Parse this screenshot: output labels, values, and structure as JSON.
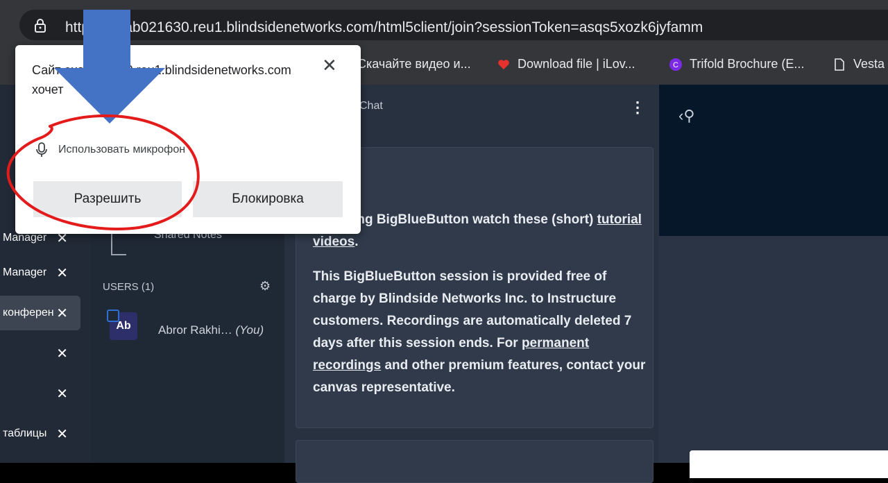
{
  "browser": {
    "url": "https://exab021630.reu1.blindsidenetworks.com/html5client/join?sessionToken=asqs5xozk6jyfamm",
    "url_visible": "https://exab021630.reu1.blindsidenetworks.com/html5client/join?sessionToken=asqs5xozk6jyfamm",
    "bookmarks": [
      {
        "label": "Скачайте видео и...",
        "icon": "video-icon"
      },
      {
        "label": "Download file | iLov...",
        "icon": "heart-icon"
      },
      {
        "label": "Trifold Brochure (E...",
        "icon": "canva-icon"
      },
      {
        "label": "Vesta",
        "icon": "page-icon"
      }
    ]
  },
  "left_strip": {
    "items": [
      {
        "label": "",
        "close": ""
      },
      {
        "label": "Manager",
        "close": "✕"
      },
      {
        "label": "Manager",
        "close": "✕"
      },
      {
        "label": "конферен",
        "close": "✕"
      },
      {
        "label": "",
        "close": "✕"
      },
      {
        "label": "",
        "close": "✕"
      },
      {
        "label": "таблицы",
        "close": "✕"
      }
    ]
  },
  "userlist": {
    "shared_notes": "Shared Notes",
    "users_header": "USERS (1)",
    "user": {
      "initials": "Ab",
      "name": "Abror Rakhi…",
      "you": "(You)"
    }
  },
  "chat": {
    "title": "Chat",
    "message_p1_pre": "…p using BigBlueButton watch these (short) ",
    "message_p1_link": "tutorial videos",
    "message_p1_post": ".",
    "message_p2_pre": "This BigBlueButton session is provided free of charge by Blindside Networks Inc. to Instructure customers. Recordings are automatically deleted 7 days after this session ends. For ",
    "message_p2_link": "permanent recordings",
    "message_p2_post": " and other premium features, contact your canvas representative."
  },
  "popup": {
    "title": "Сайт exab021630.reu1.blindsidenetworks.com хочет",
    "permission": "Использовать микрофон",
    "allow_label": "Разрешить",
    "block_label": "Блокировка",
    "close_icon": "close-icon"
  },
  "colors": {
    "annotation_arrow": "#4472c4",
    "annotation_circle": "#e31b1b"
  }
}
